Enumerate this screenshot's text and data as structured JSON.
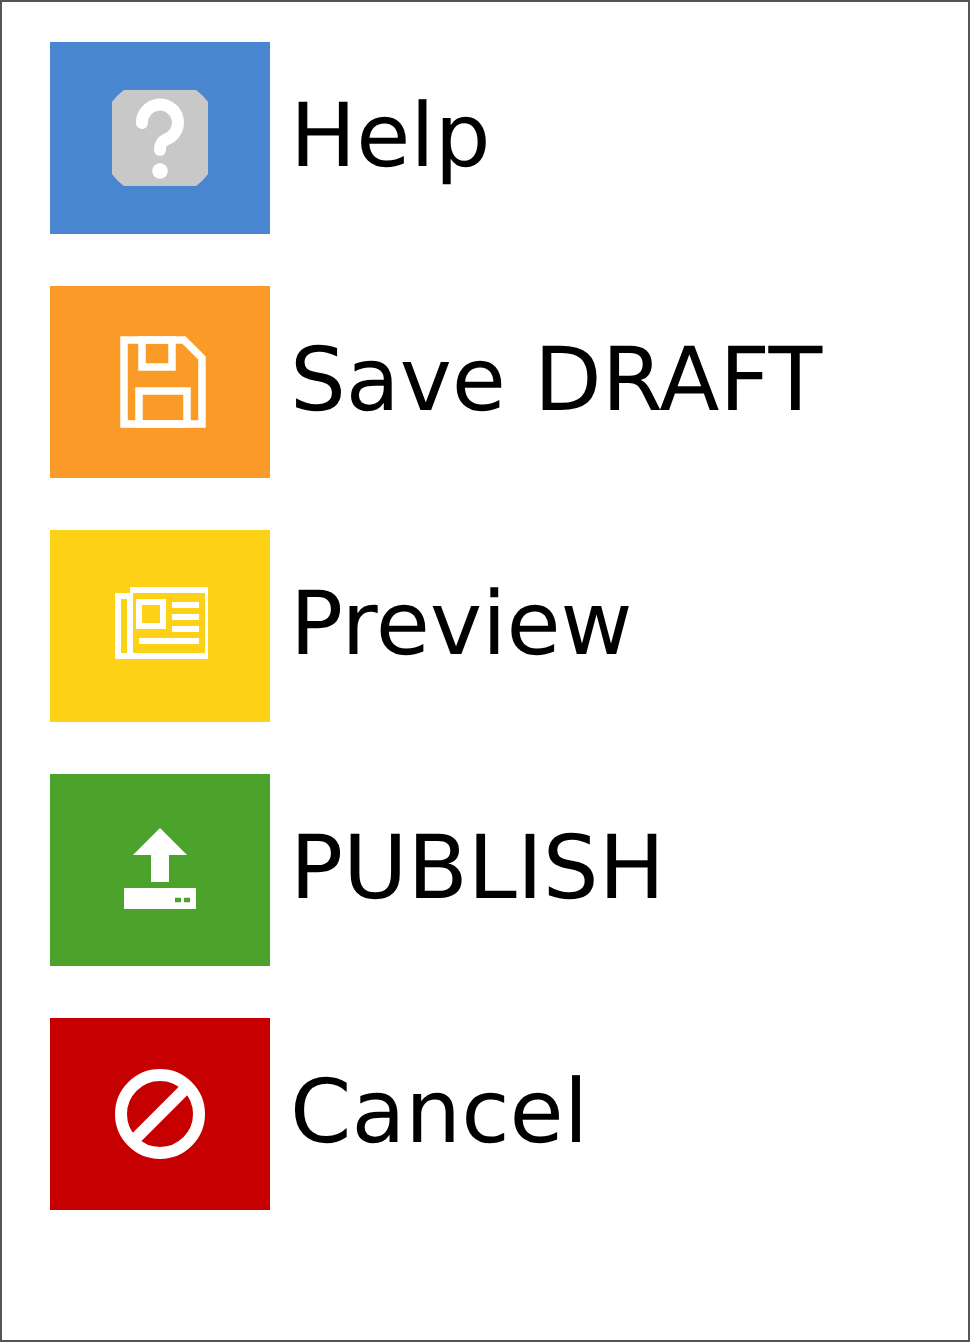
{
  "menu": [
    {
      "label": "Help",
      "kind": "help",
      "color": "#4a86d0"
    },
    {
      "label": "Save DRAFT",
      "kind": "save",
      "color": "#fa9b27"
    },
    {
      "label": "Preview",
      "kind": "preview",
      "color": "#fcd116"
    },
    {
      "label": "PUBLISH",
      "kind": "publish",
      "color": "#4ca32c"
    },
    {
      "label": "Cancel",
      "kind": "cancel",
      "color": "#c60000"
    }
  ]
}
